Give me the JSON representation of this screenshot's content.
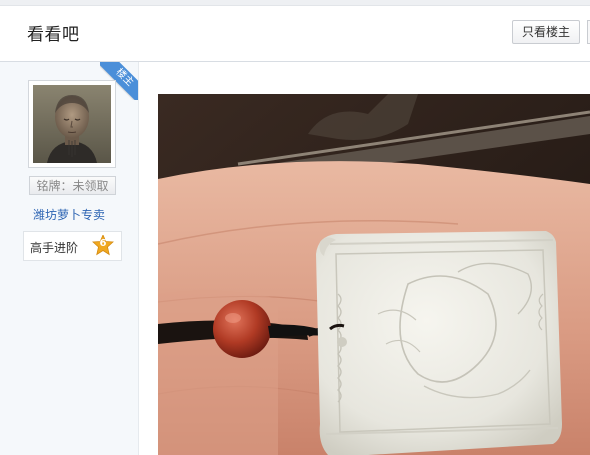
{
  "header": {
    "title": "看看吧",
    "only_op_label": "只看楼主"
  },
  "user": {
    "op_tag": "楼主",
    "badge_label": "铭牌：未领取",
    "name": "潍坊萝卜专卖",
    "level_title": "高手进阶",
    "level_number": "6"
  },
  "colors": {
    "link": "#2d64b3",
    "ribbon": "#4b8fd9",
    "level_badge": "#f0a820"
  }
}
